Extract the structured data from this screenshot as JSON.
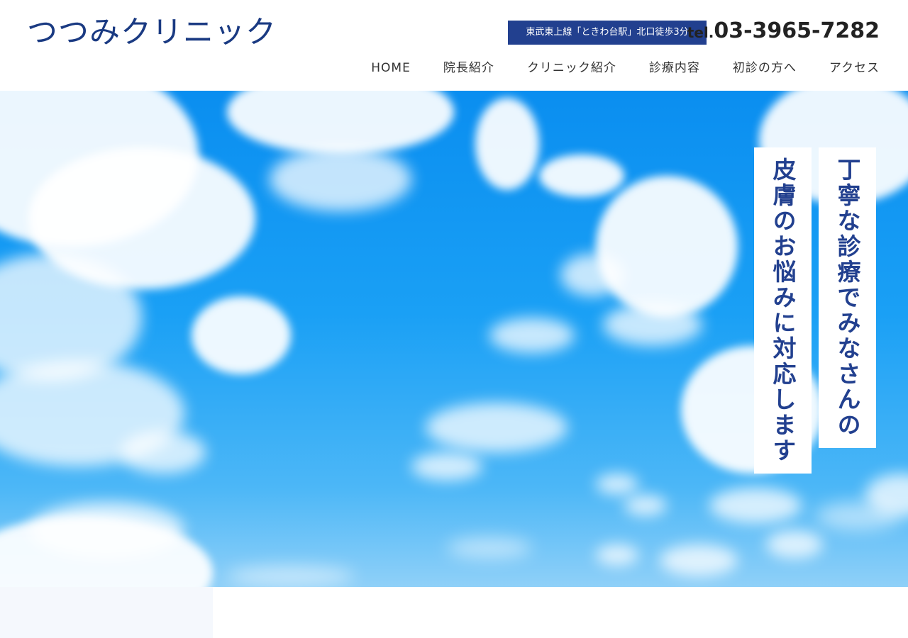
{
  "header": {
    "logo": "つつみクリニック",
    "access": "東武東上線「ときわ台駅」北口徒歩3分",
    "tel_prefix": "tel.",
    "tel_number": "03-3965-7282"
  },
  "nav": {
    "items": [
      {
        "label": "HOME"
      },
      {
        "label": "院長紹介"
      },
      {
        "label": "クリニック紹介"
      },
      {
        "label": "診療内容"
      },
      {
        "label": "初診の方へ"
      },
      {
        "label": "アクセス"
      }
    ]
  },
  "hero": {
    "catch_line_1": "丁寧な診療でみなさんの",
    "catch_line_2": "皮膚のお悩みに対応します",
    "colors": {
      "accent": "#22408f",
      "sky": "#1aa0f5"
    }
  }
}
